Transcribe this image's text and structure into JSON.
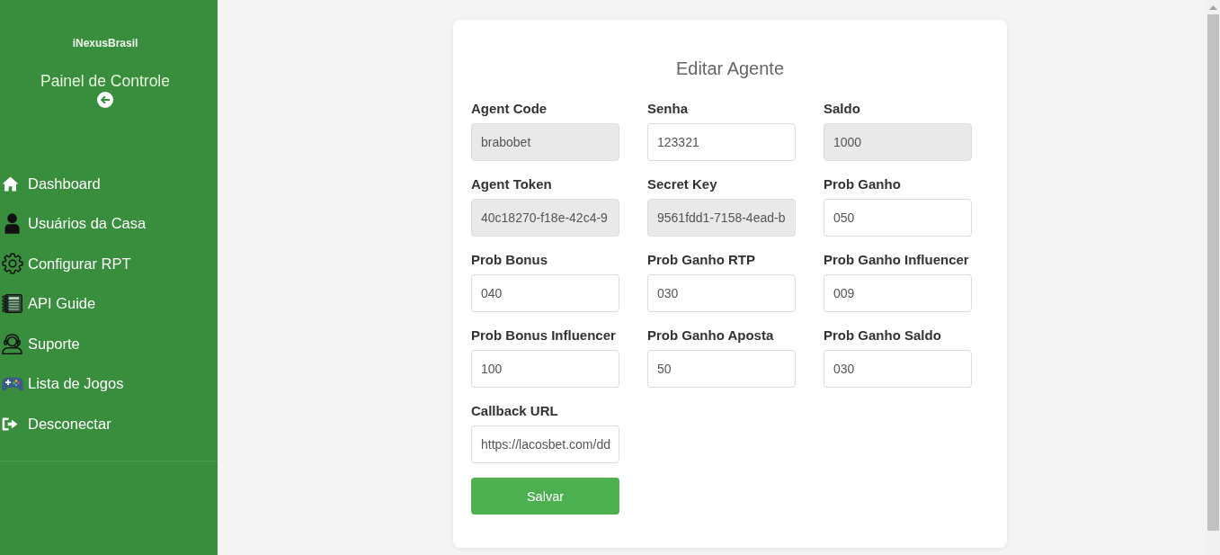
{
  "sidebar": {
    "brand": "iNexusBrasil",
    "title": "Painel de Controle",
    "items": [
      {
        "label": "Dashboard"
      },
      {
        "label": "Usuários da Casa"
      },
      {
        "label": "Configurar RPT"
      },
      {
        "label": "API Guide"
      },
      {
        "label": "Suporte"
      },
      {
        "label": "Lista de Jogos"
      },
      {
        "label": "Desconectar"
      }
    ]
  },
  "form": {
    "title": "Editar Agente",
    "fields": [
      {
        "label": "Agent Code",
        "value": "brabobet",
        "disabled": true
      },
      {
        "label": "Senha",
        "value": "123321",
        "disabled": false
      },
      {
        "label": "Saldo",
        "value": "1000",
        "disabled": true
      },
      {
        "label": "Agent Token",
        "value": "40c18270-f18e-42c4-9",
        "disabled": true
      },
      {
        "label": "Secret Key",
        "value": "9561fdd1-7158-4ead-b",
        "disabled": true
      },
      {
        "label": "Prob Ganho",
        "value": "050",
        "disabled": false
      },
      {
        "label": "Prob Bonus",
        "value": "040",
        "disabled": false
      },
      {
        "label": "Prob Ganho RTP",
        "value": "030",
        "disabled": false
      },
      {
        "label": "Prob Ganho Influencer",
        "value": "009",
        "disabled": false
      },
      {
        "label": "Prob Bonus Influencer",
        "value": "100",
        "disabled": false
      },
      {
        "label": "Prob Ganho Aposta",
        "value": "50",
        "disabled": false
      },
      {
        "label": "Prob Ganho Saldo",
        "value": "030",
        "disabled": false
      },
      {
        "label": "Callback URL",
        "value": "https://lacosbet.com/dd",
        "disabled": false
      }
    ],
    "submit": "Salvar"
  }
}
